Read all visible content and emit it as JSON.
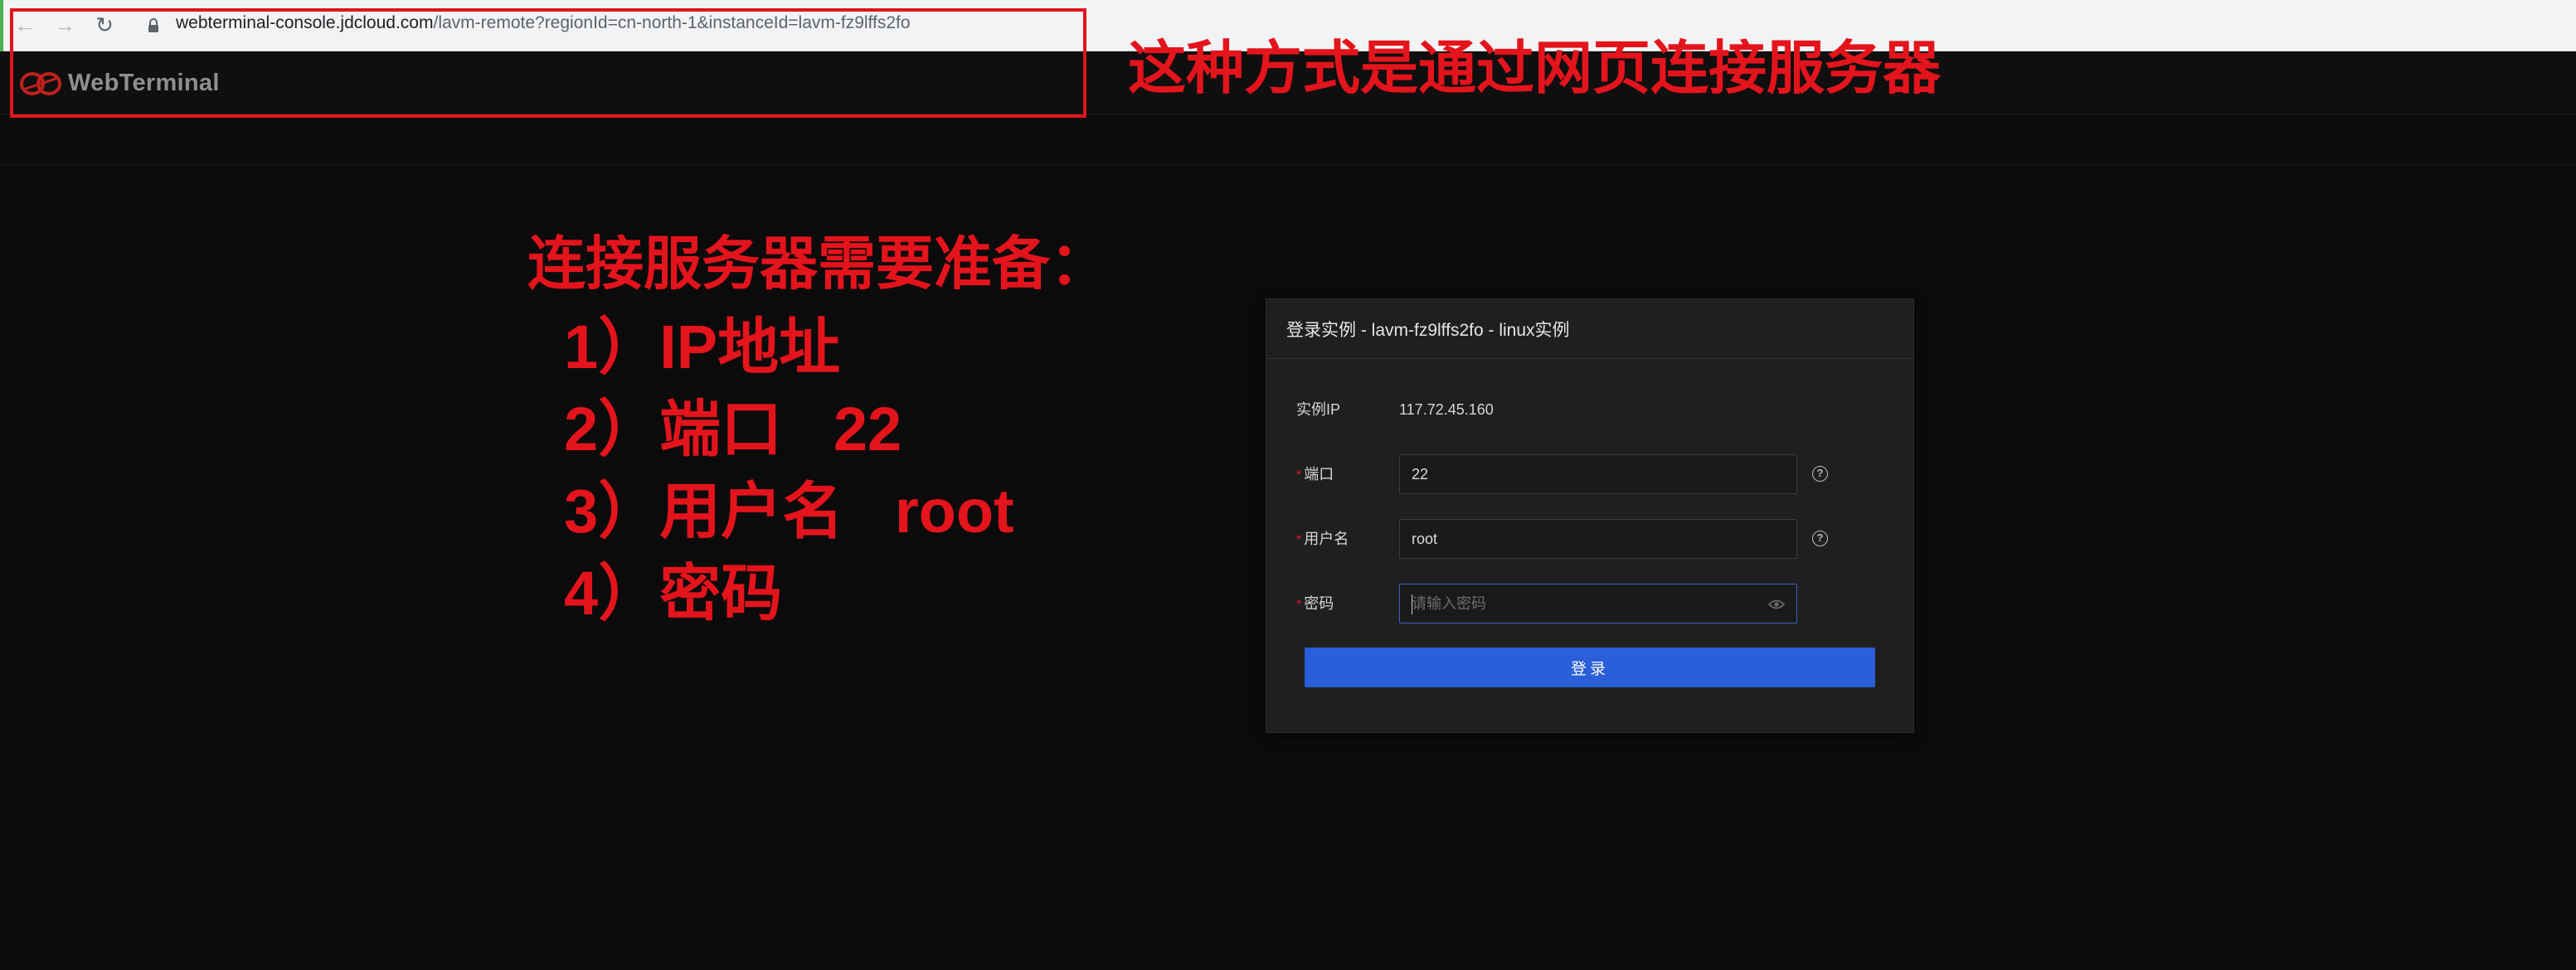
{
  "browser": {
    "url_host": "webterminal-console.jdcloud.com",
    "url_path": "/lavm-remote?regionId=cn-north-1&instanceId=lavm-fz9lffs2fo"
  },
  "app": {
    "logo_text": "WebTerminal",
    "logo_color": "#c0201c"
  },
  "annotation": {
    "title": "这种方式是通过网页连接服务器",
    "heading": "连接服务器需要准备：",
    "items": [
      "1）IP地址",
      "2）端口   22",
      "3）用户名   root",
      "4）密码"
    ],
    "color": "#e4141c"
  },
  "login_panel": {
    "title": "登录实例 - lavm-fz9lffs2fo - linux实例",
    "ip_label": "实例IP",
    "ip_value": "117.72.45.160",
    "port_label": "端口",
    "port_value": "22",
    "username_label": "用户名",
    "username_value": "root",
    "password_label": "密码",
    "password_placeholder": "请输入密码",
    "required_mark": "*",
    "help_glyph": "?",
    "submit_label": "登录",
    "button_color": "#2b5fd9"
  }
}
